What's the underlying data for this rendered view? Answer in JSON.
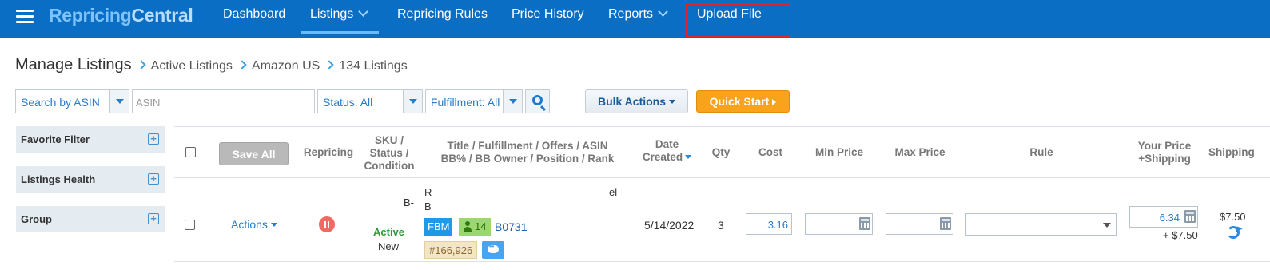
{
  "app": {
    "logo_part1": "Repricing",
    "logo_part2": "Central"
  },
  "nav": {
    "items": [
      {
        "label": "Dashboard"
      },
      {
        "label": "Listings"
      },
      {
        "label": "Repricing Rules"
      },
      {
        "label": "Price History"
      },
      {
        "label": "Reports"
      },
      {
        "label": "Upload File"
      }
    ]
  },
  "breadcrumb": {
    "title": "Manage Listings",
    "items": [
      "Active Listings",
      "Amazon US",
      "134 Listings"
    ]
  },
  "filters": {
    "search_by": "Search by ASIN",
    "asin_placeholder": "ASIN",
    "status": "Status: All",
    "fulfillment": "Fulfillment: All",
    "bulk_actions": "Bulk Actions",
    "quick_start": "Quick Start"
  },
  "sidebar": {
    "items": [
      {
        "label": "Favorite Filter"
      },
      {
        "label": "Listings Health"
      },
      {
        "label": "Group"
      }
    ],
    "plus": "+"
  },
  "table": {
    "save_all": "Save All",
    "headers": {
      "repricing": "Repricing",
      "sku_l1": "SKU /",
      "sku_l2": "Status /",
      "sku_l3": "Condition",
      "title_l1": "Title / Fulfillment / Offers / ASIN",
      "title_l2": "BB% / BB Owner / Position / Rank",
      "date_l1": "Date",
      "date_l2": "Created",
      "qty": "Qty",
      "cost": "Cost",
      "min_price": "Min Price",
      "max_price": "Max Price",
      "rule": "Rule",
      "your_price_l1": "Your Price",
      "your_price_l2": "+Shipping",
      "shipping": "Shipping"
    },
    "rows": [
      {
        "actions": "Actions",
        "sku": "B-",
        "status": "Active",
        "condition": "New",
        "title_frag_1": "R",
        "title_frag_2": "B",
        "title_frag_3": "el -",
        "fulfillment": "FBM",
        "offers": "14",
        "asin": "B0731",
        "rank": "#166,926",
        "date_created": "5/14/2022",
        "qty": "3",
        "cost": "3.16",
        "min_price": "",
        "max_price": "",
        "rule": "",
        "your_price": "6.34",
        "price_shipping": "+ $7.50",
        "shipping": "$7.50"
      }
    ]
  }
}
